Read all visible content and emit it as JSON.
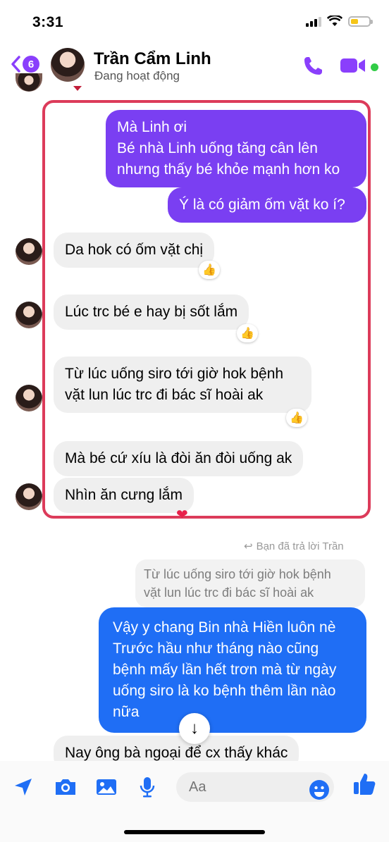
{
  "status_bar": {
    "time": "3:31"
  },
  "header": {
    "unread_count": "6",
    "contact_name": "Trần Cẩm Linh",
    "contact_status": "Đang hoạt động"
  },
  "messages": {
    "out1_line1": "Mà Linh ơi",
    "out1_line2": "Bé nhà Linh uống tăng cân lên",
    "out1_line3": "nhưng thấy bé khỏe mạnh hơn ko",
    "out2": "Ý là có giảm ốm vặt ko í?",
    "in1": "Da hok có ốm vặt chị",
    "in2": "Lúc trc bé e hay bị sốt lắm",
    "in3_line1": "Từ lúc uống siro tới giờ hok bệnh",
    "in3_line2": "vặt lun lúc trc đi bác sĩ hoài ak",
    "in4": "Mà bé cứ xíu là đòi ăn đòi uống ak",
    "in5": "Nhìn ăn cưng lắm",
    "reply_note": "Bạn đã trả lời Trần",
    "quoted_line1": "Từ lúc uống siro tới giờ hok bệnh",
    "quoted_line2": "vặt lun lúc trc đi bác sĩ hoài ak",
    "reply_line1": "Vậy y chang Bin nhà Hiền luôn nè",
    "reply_line2": "Trước hầu như tháng nào cũng",
    "reply_line3": "bệnh mấy lần hết trơn mà từ ngày",
    "reply_line4": "uống siro là ko bệnh thêm lần nào",
    "reply_line5": "nữa",
    "in6": "Nay ông bà ngoại để cx thấy khác"
  },
  "composer": {
    "placeholder": "Aa"
  },
  "colors": {
    "accent": "#7a3ff2",
    "blue": "#1f6ef5",
    "highlight": "#dc3b5a"
  }
}
